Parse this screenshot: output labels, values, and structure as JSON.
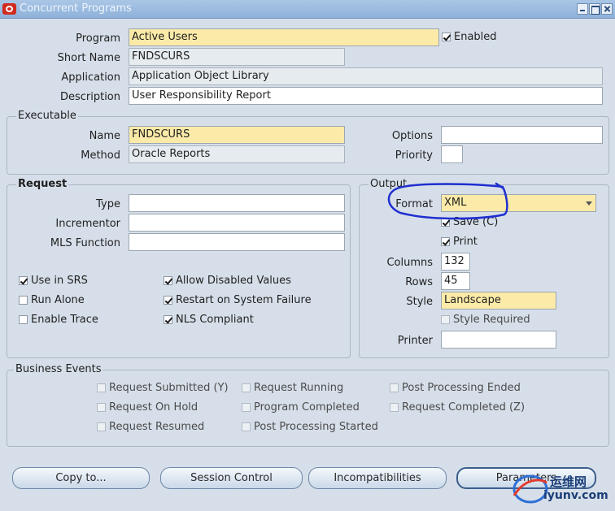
{
  "window": {
    "title": "Concurrent Programs"
  },
  "main": {
    "program_label": "Program",
    "program_value": "Active Users",
    "enabled_label": "Enabled",
    "enabled_checked": true,
    "short_name_label": "Short Name",
    "short_name_value": "FNDSCURS",
    "application_label": "Application",
    "application_value": "Application Object Library",
    "description_label": "Description",
    "description_value": "User Responsibility Report"
  },
  "executable": {
    "title": "Executable",
    "name_label": "Name",
    "name_value": "FNDSCURS",
    "method_label": "Method",
    "method_value": "Oracle Reports",
    "options_label": "Options",
    "options_value": "",
    "priority_label": "Priority",
    "priority_value": ""
  },
  "request": {
    "title": "Request",
    "type_label": "Type",
    "type_value": "",
    "incrementor_label": "Incrementor",
    "incrementor_value": "",
    "mls_label": "MLS Function",
    "mls_value": "",
    "checkboxes": [
      {
        "label": "Use in SRS",
        "checked": true
      },
      {
        "label": "Run Alone",
        "checked": false
      },
      {
        "label": "Enable Trace",
        "checked": false
      },
      {
        "label": "Allow Disabled Values",
        "checked": true
      },
      {
        "label": "Restart on System Failure",
        "checked": true
      },
      {
        "label": "NLS Compliant",
        "checked": true
      }
    ]
  },
  "output": {
    "title": "Output",
    "format_label": "Format",
    "format_value": "XML",
    "save_label": "Save (C)",
    "save_checked": true,
    "print_label": "Print",
    "print_checked": true,
    "columns_label": "Columns",
    "columns_value": "132",
    "rows_label": "Rows",
    "rows_value": "45",
    "style_label": "Style",
    "style_value": "Landscape",
    "style_required_label": "Style Required",
    "style_required_checked": false,
    "printer_label": "Printer",
    "printer_value": ""
  },
  "business_events": {
    "title": "Business Events",
    "items": [
      {
        "label": "Request Submitted (Y)"
      },
      {
        "label": "Request On Hold"
      },
      {
        "label": "Request Resumed"
      },
      {
        "label": "Request Running"
      },
      {
        "label": "Program Completed"
      },
      {
        "label": "Post Processing Started"
      },
      {
        "label": "Post Processing Ended"
      },
      {
        "label": "Request Completed (Z)"
      }
    ]
  },
  "buttons": {
    "copy_to": "Copy to...",
    "session_control": "Session Control",
    "incompatibilities": "Incompatibilities",
    "parameters": "Parameters"
  },
  "watermark": {
    "line1": "运维网",
    "line2": "iyunv.com"
  },
  "colors": {
    "required_field": "#fbeaa8",
    "annotation_ink": "#1f2fd0",
    "window_bg": "#d6dfe9"
  }
}
